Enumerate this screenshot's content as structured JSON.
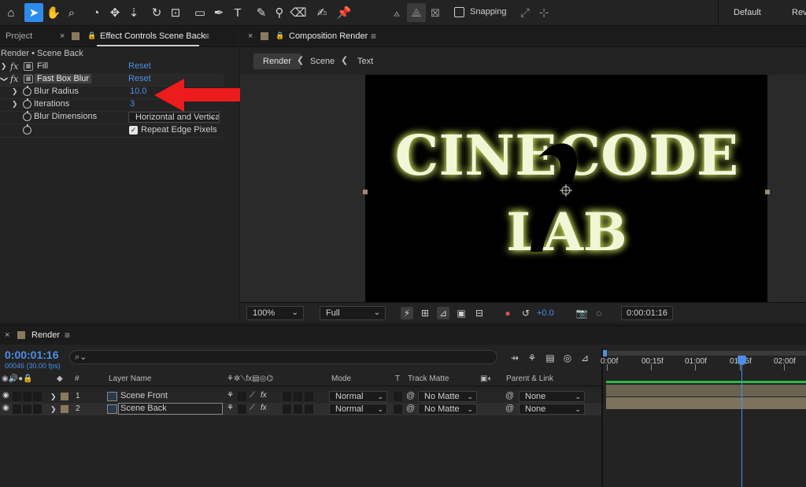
{
  "toolbar": {
    "snapping_label": "Snapping",
    "workspaces": [
      "Default",
      "Rev"
    ]
  },
  "effect_controls": {
    "tabs": {
      "project": "Project",
      "effect_controls": "Effect Controls Scene Back"
    },
    "breadcrumb": "Render • Scene Back",
    "effects": [
      {
        "name": "Fill",
        "reset": "Reset"
      },
      {
        "name": "Fast Box Blur",
        "reset": "Reset"
      }
    ],
    "properties": {
      "blur_radius": {
        "label": "Blur Radius",
        "value": "10.0"
      },
      "iterations": {
        "label": "Iterations",
        "value": "3"
      },
      "blur_dimensions": {
        "label": "Blur Dimensions",
        "value": "Horizontal and Vertical"
      },
      "repeat_edge": {
        "label": "Repeat Edge Pixels",
        "checked": true
      }
    }
  },
  "composition": {
    "tab": "Composition Render",
    "crumbs": [
      "Render",
      "Scene",
      "Text"
    ],
    "canvas_text": {
      "line1": "CINECODE",
      "line2": "LAB"
    },
    "viewer_bar": {
      "zoom": "100%",
      "resolution": "Full",
      "exposure": "+0.0",
      "timecode": "0:00:01:16"
    }
  },
  "timeline": {
    "tab": "Render",
    "current_time": "0:00:01:16",
    "frame_info": "00046 (30.00 fps)",
    "search_placeholder": "",
    "columns": {
      "num": "#",
      "layer_name": "Layer Name",
      "mode": "Mode",
      "t": "T",
      "track_matte": "Track Matte",
      "parent": "Parent & Link"
    },
    "layers": [
      {
        "num": "1",
        "name": "Scene Front",
        "mode": "Normal",
        "matte": "No Matte",
        "parent": "None"
      },
      {
        "num": "2",
        "name": "Scene Back",
        "mode": "Normal",
        "matte": "No Matte",
        "parent": "None"
      }
    ],
    "ruler_ticks": [
      "0:00f",
      "00:15f",
      "01:00f",
      "01:15f",
      "02:00f"
    ]
  },
  "colors": {
    "accent": "#4d8fe8",
    "annotation_arrow": "#ec1c1c",
    "glow": "#e8f0b0"
  }
}
